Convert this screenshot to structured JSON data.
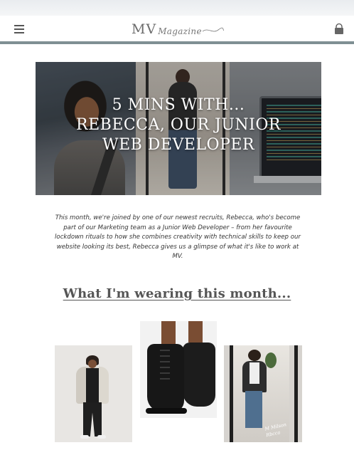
{
  "header": {
    "logo_main": "MV",
    "logo_script": "Magazine",
    "menu_icon": "hamburger-menu-icon",
    "bag_icon": "shopping-bag-icon",
    "rule_color": "#7f8f93"
  },
  "hero": {
    "title_line1": "5 MINS WITH...",
    "title_line2": "REBECCA, OUR JUNIOR",
    "title_line3": "WEB DEVELOPER"
  },
  "intro": {
    "text": "This month, we're joined by one of our newest recruits, Rebecca, who's become part of our Marketing team as a Junior Web Developer – from her favourite lockdown rituals to how she combines creativity with technical skills to keep our website looking its best, Rebecca gives us a glimpse of what it's like to work at MV."
  },
  "section": {
    "heading": "What I'm wearing this month..."
  },
  "outfit": {
    "signature": "M Milson Rbcca"
  }
}
